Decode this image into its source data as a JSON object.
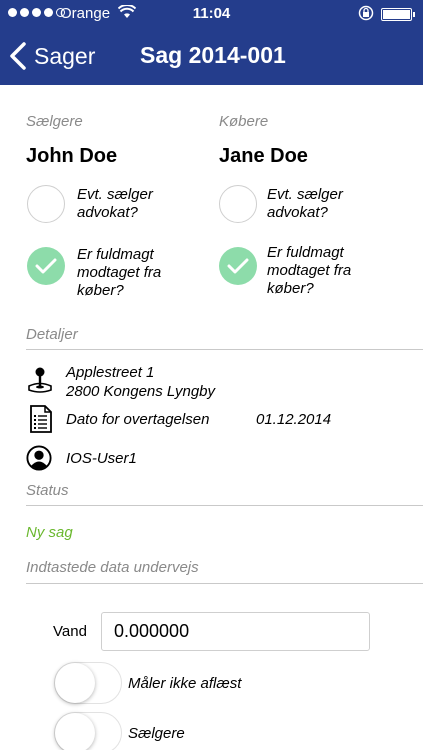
{
  "status_bar": {
    "carrier": "Orange",
    "time": "11:04",
    "signal_icon": "signal-dots-icon",
    "wifi_icon": "wifi-icon",
    "lock_icon": "rotation-lock-icon",
    "battery_icon": "battery-icon"
  },
  "nav": {
    "back_label": "Sager",
    "title": "Sag 2014-001",
    "background": "#243d8c"
  },
  "sellers": {
    "header": "Sælgere",
    "name": "John Doe",
    "lawyer_label": "Evt. sælger\nadvokat?",
    "lawyer_checked": false,
    "proxy_label": "Er fuldmagt\nmodtaget fra\nkøber?",
    "proxy_checked": true
  },
  "buyers": {
    "header": "Købere",
    "name": "Jane Doe",
    "lawyer_label": "Evt. sælger\nadvokat?",
    "lawyer_checked": false,
    "proxy_label": "Er fuldmagt\nmodtaget fra\nkøber?",
    "proxy_checked": true
  },
  "details": {
    "header": "Detaljer",
    "address_line1": "Applestreet 1",
    "address_line2": "2800 Kongens Lyngby",
    "date_label": "Dato for overtagelsen",
    "date_value": "01.12.2014",
    "user": "IOS-User1",
    "icons": [
      "joystick-icon",
      "document-icon",
      "user-icon"
    ]
  },
  "status": {
    "header": "Status",
    "value": "Ny sag",
    "color": "#6ab82e"
  },
  "entered": {
    "header": "Indtastede data undervejs",
    "water_label": "Vand",
    "water_value": "0.000000",
    "toggles": [
      {
        "label": "Måler ikke aflæst",
        "on": false
      },
      {
        "label": "Sælgere",
        "on": false
      }
    ]
  },
  "colors": {
    "check_on": "#8ddcaa",
    "section_label": "#8a8a8a"
  }
}
